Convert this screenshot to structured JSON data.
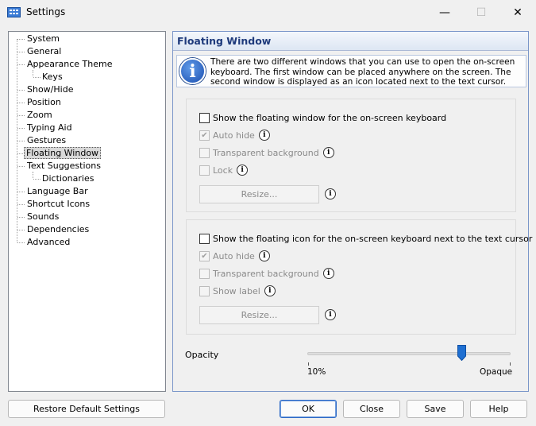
{
  "window": {
    "title": "Settings",
    "minimize": "—",
    "maximize": "☐",
    "close": "✕"
  },
  "tree": {
    "items": [
      {
        "label": "System"
      },
      {
        "label": "General"
      },
      {
        "label": "Appearance Theme"
      },
      {
        "label": "Keys"
      },
      {
        "label": "Show/Hide"
      },
      {
        "label": "Position"
      },
      {
        "label": "Zoom"
      },
      {
        "label": "Typing Aid"
      },
      {
        "label": "Gestures"
      },
      {
        "label": "Floating Window"
      },
      {
        "label": "Text Suggestions"
      },
      {
        "label": "Dictionaries"
      },
      {
        "label": "Language Bar"
      },
      {
        "label": "Shortcut Icons"
      },
      {
        "label": "Sounds"
      },
      {
        "label": "Dependencies"
      },
      {
        "label": "Advanced"
      }
    ],
    "selected": "Floating Window"
  },
  "panel": {
    "title": "Floating Window",
    "info_glyph": "i",
    "info_text": "There are two different windows that you can use to open the on-screen keyboard. The first window can be placed anywhere on the screen. The second window is displayed as an icon located next to the text cursor.",
    "group1": {
      "main_checkbox": "Show the floating window for the on-screen keyboard",
      "auto_hide": "Auto hide",
      "transparent_background": "Transparent background",
      "lock": "Lock",
      "resize": "Resize..."
    },
    "group2": {
      "main_checkbox": "Show the floating icon for the on-screen keyboard next to the text cursor",
      "auto_hide": "Auto hide",
      "transparent_background": "Transparent background",
      "show_label": "Show label",
      "resize": "Resize..."
    },
    "opacity": {
      "label": "Opacity",
      "min_label": "10%",
      "max_label": "Opaque",
      "value_fraction": 0.76
    }
  },
  "buttons": {
    "restore": "Restore Default Settings",
    "ok": "OK",
    "close": "Close",
    "save": "Save",
    "help": "Help"
  },
  "colors": {
    "accent": "#1e3a7b",
    "slider_thumb": "#1f6fd1"
  }
}
